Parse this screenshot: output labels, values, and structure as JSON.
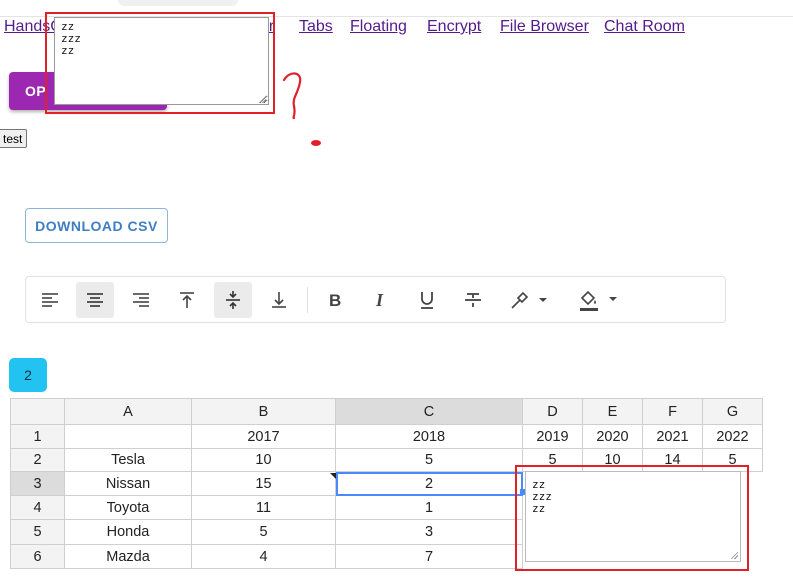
{
  "nav": {
    "links": [
      {
        "label": "HandsC"
      },
      {
        "label": "er"
      },
      {
        "label": "Tabs"
      },
      {
        "label": "Floating"
      },
      {
        "label": "Encrypt"
      },
      {
        "label": "File Browser"
      },
      {
        "label": "Chat Room"
      }
    ]
  },
  "open_button": {
    "label": "OP"
  },
  "floating_textarea": {
    "value": "zz\nzzz\nzz"
  },
  "test_button": {
    "label": "test"
  },
  "download_button": {
    "label": "DOWNLOAD CSV"
  },
  "toolbar": {
    "buttons": [
      {
        "icon": "align-left-icon",
        "active": false
      },
      {
        "icon": "align-center-icon",
        "active": true
      },
      {
        "icon": "align-right-icon",
        "active": false
      },
      {
        "icon": "align-top-icon",
        "active": false
      },
      {
        "icon": "align-middle-icon",
        "active": true
      },
      {
        "icon": "align-bottom-icon",
        "active": false
      },
      {
        "icon": "bold-icon",
        "active": false
      },
      {
        "icon": "italic-icon",
        "active": false
      },
      {
        "icon": "underline-icon",
        "active": false
      },
      {
        "icon": "strikethrough-icon",
        "active": false
      },
      {
        "icon": "text-color-icon",
        "active": false
      },
      {
        "icon": "fill-color-icon",
        "active": false
      }
    ]
  },
  "count_badge": {
    "label": "2"
  },
  "sheet": {
    "columns": [
      "A",
      "B",
      "C",
      "D",
      "E",
      "F",
      "G"
    ],
    "selected_column": "C",
    "selected_row": "3",
    "rows": [
      {
        "header": "1",
        "cells": [
          "",
          "2017",
          "2018",
          "2019",
          "2020",
          "2021",
          "2022"
        ]
      },
      {
        "header": "2",
        "cells": [
          "Tesla",
          "10",
          "5",
          "5",
          "10",
          "14",
          "5"
        ]
      },
      {
        "header": "3",
        "cells": [
          "Nissan",
          "15",
          "2",
          "",
          "",
          "",
          ""
        ]
      },
      {
        "header": "4",
        "cells": [
          "Toyota",
          "11",
          "1",
          "",
          "",
          "",
          ""
        ]
      },
      {
        "header": "5",
        "cells": [
          "Honda",
          "5",
          "3",
          "",
          "",
          "",
          ""
        ]
      },
      {
        "header": "6",
        "cells": [
          "Mazda",
          "4",
          "7",
          "",
          "",
          "",
          ""
        ]
      }
    ],
    "cell_editor": {
      "value": "zz\nzzz\nzz"
    }
  },
  "colors": {
    "open_button": "#9c27b0",
    "download_border": "#90b4d6",
    "download_text": "#3f7ec1",
    "badge": "#22c3f0",
    "annotation_red": "#e0202a",
    "selection_blue": "#4b89ff"
  }
}
